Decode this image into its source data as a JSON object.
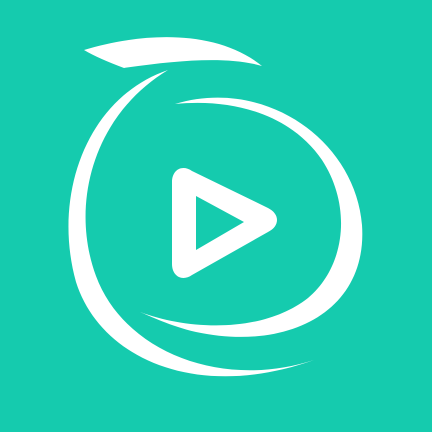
{
  "app_icon": {
    "name": "video-player-app-icon",
    "icon": "play-icon",
    "colors": {
      "background": "#15CBAE",
      "foreground": "#FFFFFF"
    }
  }
}
